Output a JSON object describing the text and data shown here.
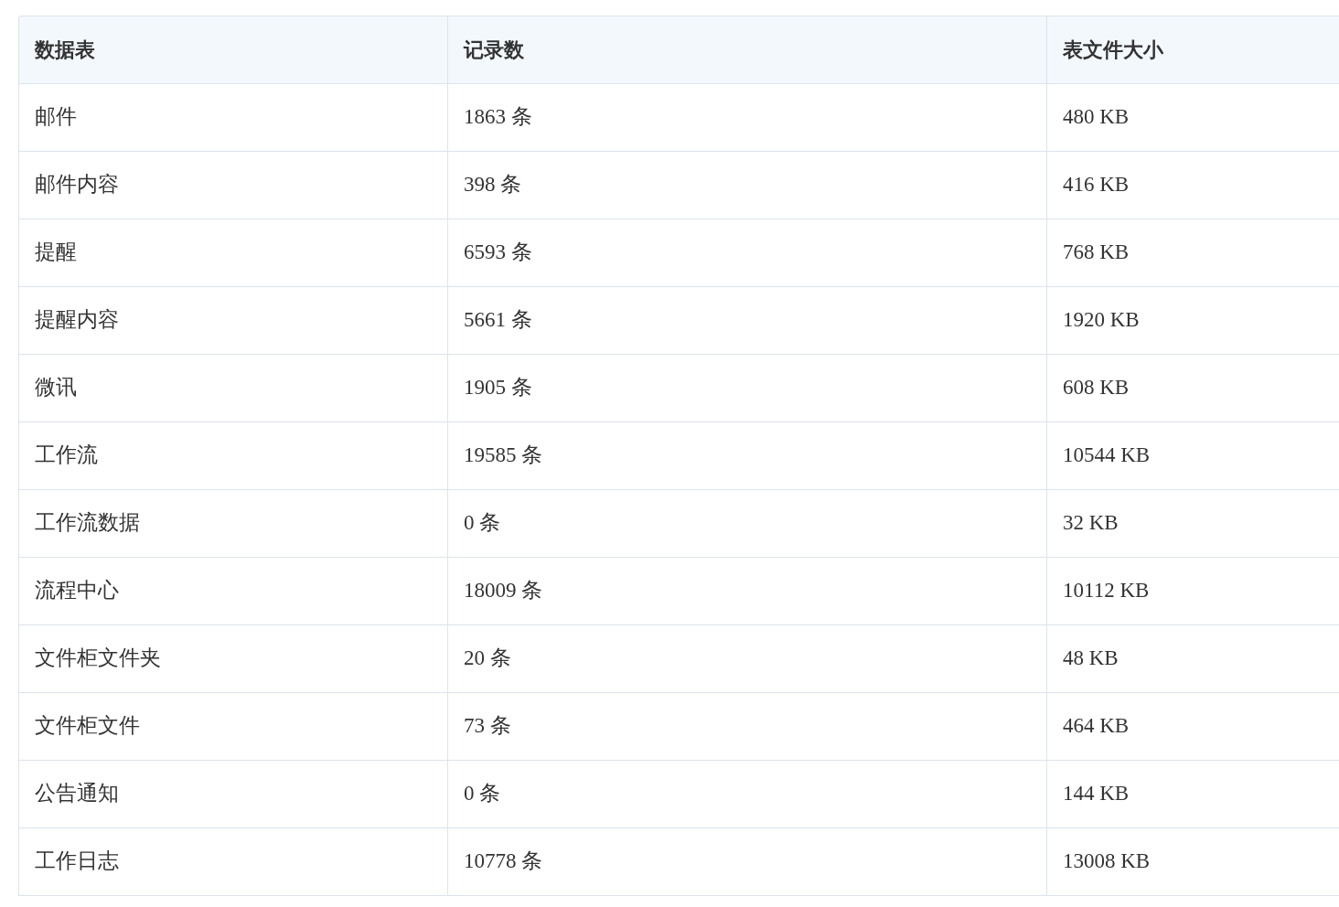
{
  "table": {
    "columns": [
      "数据表",
      "记录数",
      "表文件大小"
    ],
    "rows": [
      [
        "邮件",
        "1863 条",
        "480 KB"
      ],
      [
        "邮件内容",
        "398 条",
        "416 KB"
      ],
      [
        "提醒",
        "6593 条",
        "768 KB"
      ],
      [
        "提醒内容",
        "5661 条",
        "1920 KB"
      ],
      [
        "微讯",
        "1905 条",
        "608 KB"
      ],
      [
        "工作流",
        "19585 条",
        "10544 KB"
      ],
      [
        "工作流数据",
        "0 条",
        "32 KB"
      ],
      [
        "流程中心",
        "18009 条",
        "10112 KB"
      ],
      [
        "文件柜文件夹",
        "20 条",
        "48 KB"
      ],
      [
        "文件柜文件",
        "73 条",
        "464 KB"
      ],
      [
        "公告通知",
        "0 条",
        "144 KB"
      ],
      [
        "工作日志",
        "10778 条",
        "13008 KB"
      ]
    ]
  }
}
